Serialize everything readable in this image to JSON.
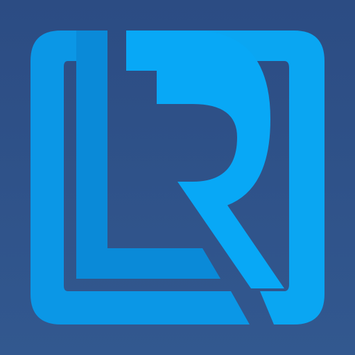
{
  "app_icon": {
    "icon_name": "lr-monogram-logo-icon",
    "colors": {
      "background": "#2f5088",
      "frame_light": "#0aa6f2",
      "frame_dark": "#0a8ad8",
      "letter_r": "#08a8f6"
    }
  }
}
